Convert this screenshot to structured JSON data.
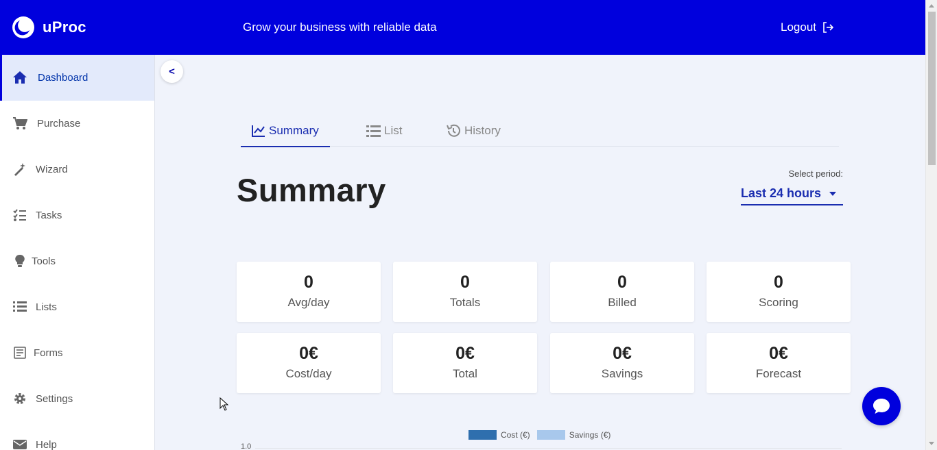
{
  "header": {
    "brand": "uProc",
    "tagline": "Grow your business with reliable data",
    "logout_label": "Logout"
  },
  "sidebar": {
    "items": [
      {
        "label": "Dashboard",
        "icon": "home-icon",
        "active": true
      },
      {
        "label": "Purchase",
        "icon": "cart-icon"
      },
      {
        "label": "Wizard",
        "icon": "magic-wand-icon"
      },
      {
        "label": "Tasks",
        "icon": "tasks-icon"
      },
      {
        "label": "Tools",
        "icon": "lightbulb-icon"
      },
      {
        "label": "Lists",
        "icon": "list-icon"
      },
      {
        "label": "Forms",
        "icon": "form-icon"
      },
      {
        "label": "Settings",
        "icon": "gear-icon"
      },
      {
        "label": "Help",
        "icon": "envelope-icon"
      }
    ]
  },
  "collapse_label": "<",
  "tabs": [
    {
      "label": "Summary",
      "icon": "chart-line-icon",
      "active": true
    },
    {
      "label": "List",
      "icon": "list-icon"
    },
    {
      "label": "History",
      "icon": "history-icon"
    }
  ],
  "page_title": "Summary",
  "period": {
    "label": "Select period:",
    "selected": "Last 24 hours"
  },
  "stats": [
    {
      "value": "0",
      "label": "Avg/day"
    },
    {
      "value": "0",
      "label": "Totals"
    },
    {
      "value": "0",
      "label": "Billed"
    },
    {
      "value": "0",
      "label": "Scoring"
    },
    {
      "value": "0€",
      "label": "Cost/day"
    },
    {
      "value": "0€",
      "label": "Total"
    },
    {
      "value": "0€",
      "label": "Savings"
    },
    {
      "value": "0€",
      "label": "Forecast"
    }
  ],
  "chart_data": {
    "type": "bar",
    "series": [
      {
        "name": "Cost (€)",
        "color": "#2f6fae",
        "values": []
      },
      {
        "name": "Savings (€)",
        "color": "#a8c8ec",
        "values": []
      }
    ],
    "y_tick_top": "1.0",
    "legend_position": "top-center"
  },
  "colors": {
    "brand": "#0000dd",
    "accent": "#1a2db0"
  }
}
